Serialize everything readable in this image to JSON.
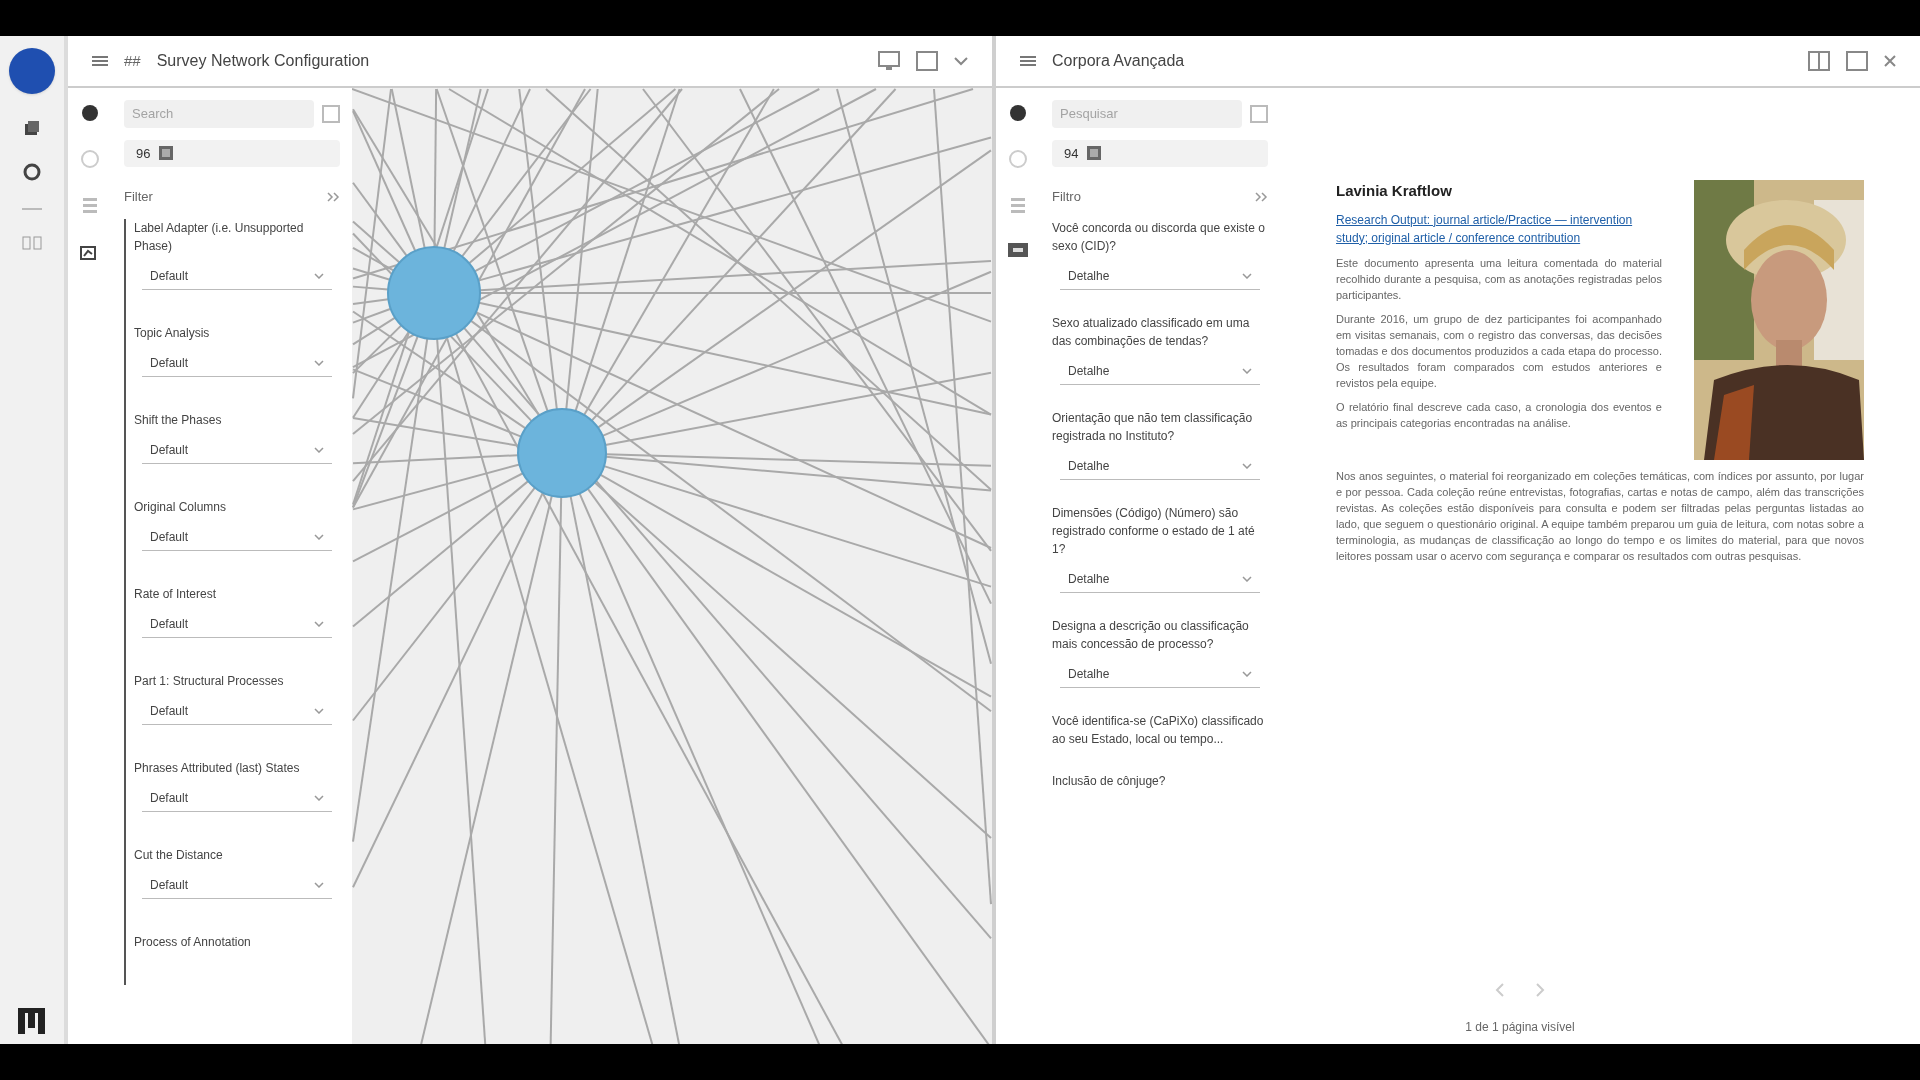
{
  "left_window": {
    "number": "##",
    "title": "Survey Network Configuration",
    "search": {
      "placeholder": "Search"
    },
    "count": "96",
    "filter_title": "Filter",
    "filters": [
      {
        "label": "Label Adapter (i.e. Unsupported Phase)",
        "value": "Default"
      },
      {
        "label": "Topic Analysis",
        "value": "Default"
      },
      {
        "label": "Shift the Phases",
        "value": "Default"
      },
      {
        "label": "Original Columns",
        "value": "Default"
      },
      {
        "label": "Rate of Interest",
        "value": "Default"
      },
      {
        "label": "Part 1: Structural Processes",
        "value": "Default"
      },
      {
        "label": "Phrases Attributed (last) States",
        "value": "Default"
      },
      {
        "label": "Cut the Distance",
        "value": "Default"
      },
      {
        "label": "Process of Annotation"
      }
    ]
  },
  "right_window": {
    "title": "Corpora Avançada",
    "search": {
      "placeholder": "Pesquisar"
    },
    "count": "94",
    "filter_title": "Filtro",
    "questions": [
      {
        "label": "Você concorda ou discorda que existe o sexo (CID)?",
        "value": "Detalhe"
      },
      {
        "label": "Sexo atualizado classificado em uma das combinações de tendas?",
        "value": "Detalhe"
      },
      {
        "label": "Orientação que não tem classificação registrada no Instituto?",
        "value": "Detalhe"
      },
      {
        "label": "Dimensões (Código) (Número) são registrado conforme o estado de 1 até 1?",
        "value": "Detalhe"
      },
      {
        "label": "Designa a descrição ou classificação mais concessão de processo?",
        "value": "Detalhe"
      },
      {
        "label": "Você identifica-se (CaPiXo) classificado ao seu Estado, local ou tempo..."
      },
      {
        "label": "Inclusão de cônjuge?"
      }
    ],
    "article": {
      "title": "Lavinia Kraftlow",
      "link": "Research Output: journal article/Practice — intervention study; original article / conference contribution",
      "paragraphs": [
        "Este documento apresenta uma leitura comentada do material recolhido durante a pesquisa, com as anotações registradas pelos participantes.",
        "Durante 2016, um grupo de dez participantes foi acompanhado em visitas semanais, com o registro das conversas, das decisões tomadas e dos documentos produzidos a cada etapa do processo. Os resultados foram comparados com estudos anteriores e revistos pela equipe.",
        "O relatório final descreve cada caso, a cronologia dos eventos e as principais categorias encontradas na análise.",
        "Nos anos seguintes, o material foi reorganizado em coleções temáticas, com índices por assunto, por lugar e por pessoa. Cada coleção reúne entrevistas, fotografias, cartas e notas de campo, além das transcrições revistas. As coleções estão disponíveis para consulta e podem ser filtradas pelas perguntas listadas ao lado, que seguem o questionário original. A equipe também preparou um guia de leitura, com notas sobre a terminologia, as mudanças de classificação ao longo do tempo e os limites do material, para que novos leitores possam usar o acervo com segurança e comparar os resultados com outras pesquisas."
      ]
    },
    "pager": "1 de 1 página visível"
  }
}
